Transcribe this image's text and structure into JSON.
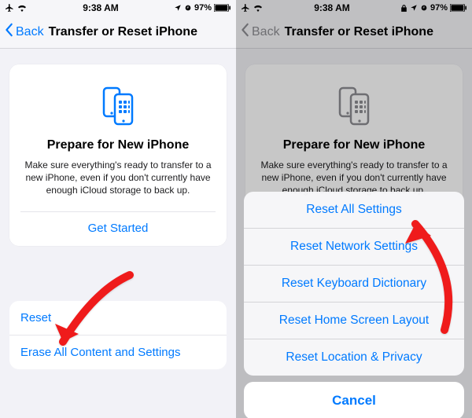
{
  "status": {
    "time": "9:38 AM",
    "battery": "97%"
  },
  "nav": {
    "back": "Back",
    "title": "Transfer or Reset iPhone"
  },
  "card": {
    "heading": "Prepare for New iPhone",
    "body": "Make sure everything's ready to transfer to a new iPhone, even if you don't currently have enough iCloud storage to back up.",
    "cta": "Get Started"
  },
  "group": {
    "reset": "Reset",
    "erase": "Erase All Content and Settings"
  },
  "sheet": {
    "options": {
      "0": "Reset All Settings",
      "1": "Reset Network Settings",
      "2": "Reset Keyboard Dictionary",
      "3": "Reset Home Screen Layout",
      "4": "Reset Location & Privacy"
    },
    "cancel": "Cancel"
  },
  "peek_row": "Erase All Content and Settings"
}
